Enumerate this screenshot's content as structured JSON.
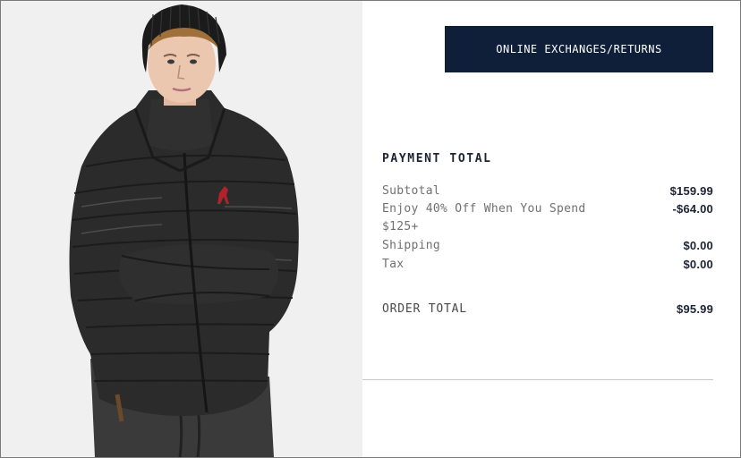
{
  "actions": {
    "exchange_returns_label": "ONLINE EXCHANGES/RETURNS"
  },
  "summary": {
    "title": "PAYMENT TOTAL",
    "rows": [
      {
        "label": "Subtotal",
        "value": "$159.99"
      },
      {
        "label": "Enjoy 40% Off When You Spend $125+",
        "value": "-$64.00"
      },
      {
        "label": "Shipping",
        "value": "$0.00"
      },
      {
        "label": "Tax",
        "value": "$0.00"
      }
    ],
    "order_total": {
      "label": "ORDER TOTAL",
      "value": "$95.99"
    }
  },
  "colors": {
    "button_bg": "#0f1f3a",
    "text_dark": "#1d2235",
    "text_muted": "#707070",
    "logo_red": "#b3222b"
  },
  "product_image": {
    "subject": "man wearing black down puffer jacket and black knit beanie",
    "logo_icon": "polo-pony-logo"
  }
}
